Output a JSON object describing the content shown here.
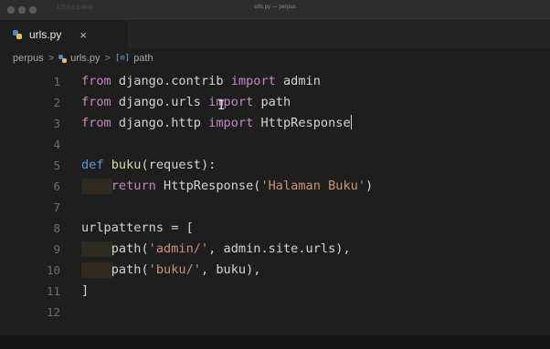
{
  "window": {
    "title": "urls.py — perpus",
    "address": "127.0.0.1:8000"
  },
  "tab": {
    "label": "urls.py",
    "close_glyph": "×",
    "icon": "python-file-icon"
  },
  "breadcrumb": {
    "folder": "perpus",
    "separator": ">",
    "file": "urls.py",
    "symbol_glyph": "[⊙]",
    "symbol": "path"
  },
  "editor": {
    "lines": [
      {
        "number": "1",
        "tokens": [
          [
            "kw",
            "from"
          ],
          [
            "plain",
            " django.contrib "
          ],
          [
            "kw",
            "import"
          ],
          [
            "plain",
            " admin"
          ]
        ]
      },
      {
        "number": "2",
        "tokens": [
          [
            "kw",
            "from"
          ],
          [
            "plain",
            " django.urls "
          ],
          [
            "kw",
            "import"
          ],
          [
            "plain",
            " path"
          ]
        ]
      },
      {
        "number": "3",
        "tokens": [
          [
            "kw",
            "from"
          ],
          [
            "plain",
            " django.http "
          ],
          [
            "kw",
            "import"
          ],
          [
            "plain",
            " HttpResponse"
          ]
        ],
        "cursor": true
      },
      {
        "number": "4",
        "tokens": []
      },
      {
        "number": "5",
        "tokens": [
          [
            "blue",
            "def"
          ],
          [
            "plain",
            " "
          ],
          [
            "fn",
            "buku"
          ],
          [
            "plain",
            "(request):"
          ]
        ]
      },
      {
        "number": "6",
        "tokens": [
          [
            "plain",
            "    "
          ],
          [
            "kw",
            "return"
          ],
          [
            "plain",
            " HttpResponse("
          ],
          [
            "str",
            "'Halaman Buku'"
          ],
          [
            "plain",
            ")"
          ]
        ],
        "guide": true
      },
      {
        "number": "7",
        "tokens": []
      },
      {
        "number": "8",
        "tokens": [
          [
            "plain",
            "urlpatterns = ["
          ]
        ]
      },
      {
        "number": "9",
        "tokens": [
          [
            "plain",
            "    path("
          ],
          [
            "str",
            "'admin/'"
          ],
          [
            "plain",
            ", admin.site.urls),"
          ]
        ],
        "guide": true
      },
      {
        "number": "10",
        "tokens": [
          [
            "plain",
            "    path("
          ],
          [
            "str",
            "'buku/'"
          ],
          [
            "plain",
            ", buku),"
          ]
        ],
        "guide": true
      },
      {
        "number": "11",
        "tokens": [
          [
            "plain",
            "]"
          ]
        ]
      },
      {
        "number": "12",
        "tokens": []
      }
    ]
  },
  "colors": {
    "keyword": "#c586c0",
    "def_keyword": "#569cd6",
    "function": "#dcdcaa",
    "string": "#ce9178",
    "text": "#d4d4d4",
    "line_number": "#6e6e6e",
    "background": "#1e1e1e"
  }
}
